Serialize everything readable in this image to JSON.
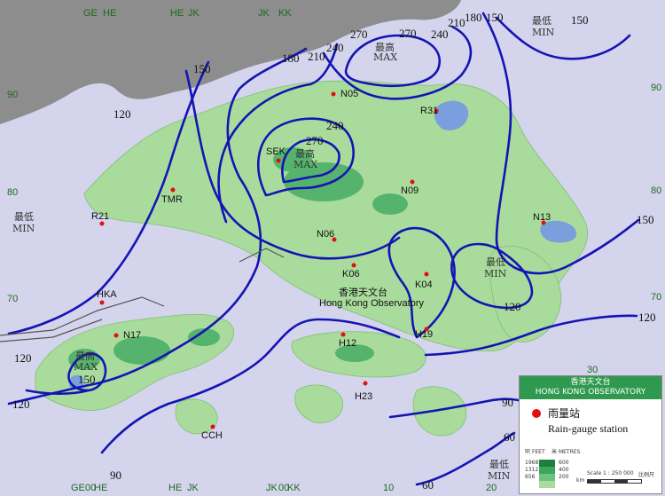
{
  "colors": {
    "sea": "#d4d4ec",
    "land": "#a9dc9c",
    "high": "#3ba65e",
    "china": "#8d8d8d",
    "isohyet": "#1414b4",
    "station": "#e01010"
  },
  "isohyet_labels": [
    "60",
    "90",
    "120",
    "150",
    "180",
    "210",
    "240",
    "270"
  ],
  "extrema": [
    {
      "zh": "最低",
      "en": "MIN"
    },
    {
      "zh": "最高",
      "en": "MAX"
    },
    {
      "zh": "最高",
      "en": "MAX"
    },
    {
      "zh": "最低",
      "en": "MIN"
    },
    {
      "zh": "最低",
      "en": "MIN"
    },
    {
      "zh": "最低",
      "en": "MIN"
    },
    {
      "zh": "最高",
      "en": "MAX"
    }
  ],
  "stations": [
    "N05",
    "R31",
    "SEK",
    "N09",
    "TMR",
    "R21",
    "N13",
    "N06",
    "K06",
    "K04",
    "HKA",
    "N17",
    "H12",
    "H19",
    "H23",
    "CCH"
  ],
  "grid_labels": {
    "top": [
      "GE",
      "HE",
      "HE",
      "JK",
      "JK",
      "KK"
    ],
    "bottom": [
      "GE",
      "00",
      "HE",
      "HE",
      "JK",
      "JK",
      "00",
      "KK",
      "10",
      "20"
    ],
    "left": [
      "90",
      "80",
      "70"
    ],
    "right": [
      "90",
      "80",
      "70"
    ],
    "bottom_right": "30"
  },
  "observatory": {
    "zh": "香港天文台",
    "en": "Hong Kong Observatory"
  },
  "legend": {
    "title_zh": "香港天文台",
    "title_en": "HONG KONG OBSERVATORY",
    "gauge_zh": "雨量站",
    "gauge_en": "Rain-gauge station",
    "feet_zh": "呎",
    "feet_en": "FEET",
    "metres_zh": "米",
    "metres_en": "METRES",
    "feet_values": [
      "1968",
      "1312",
      "656"
    ],
    "metres_values": [
      "600",
      "400",
      "200"
    ],
    "scale_text": "Scale 1 : 250 000",
    "scale_zh": "比例尺",
    "scale_unit": "km"
  }
}
